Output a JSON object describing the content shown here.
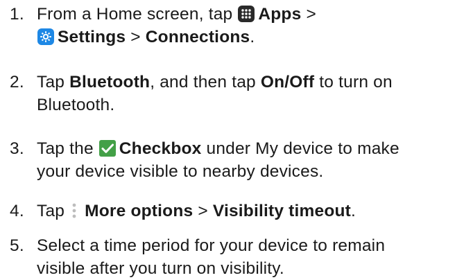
{
  "steps": [
    {
      "number": "1.",
      "t1": "From a Home screen, tap ",
      "b1": "Apps",
      "t2": " >",
      "b2": "Settings",
      "t3": " > ",
      "b3": "Connections",
      "t4": ".",
      "icons": [
        "apps-icon",
        "settings-icon"
      ]
    },
    {
      "number": "2.",
      "t1": "Tap ",
      "b1": "Bluetooth",
      "t2": ", and then tap ",
      "b2": "On/Off",
      "t3": " to turn on",
      "t4": "Bluetooth."
    },
    {
      "number": "3.",
      "t1": "Tap the ",
      "b1": "Checkbox",
      "t2": " under My device to make",
      "t3": "your device visible to nearby devices.",
      "icons": [
        "checkbox-icon"
      ]
    },
    {
      "number": "4.",
      "t1": "Tap ",
      "b1": "More options",
      "t2": " > ",
      "b2": "Visibility timeout",
      "t3": ".",
      "icons": [
        "more-options-icon"
      ]
    },
    {
      "number": "5.",
      "t1": "Select a time period for your device to remain",
      "t2": "visible after you turn on visibility."
    }
  ],
  "colors": {
    "apps_icon": "#2a2a2a",
    "settings_icon": "#1e88e5",
    "checkbox_icon": "#43a047",
    "more_icon": "#bdbdbd"
  }
}
